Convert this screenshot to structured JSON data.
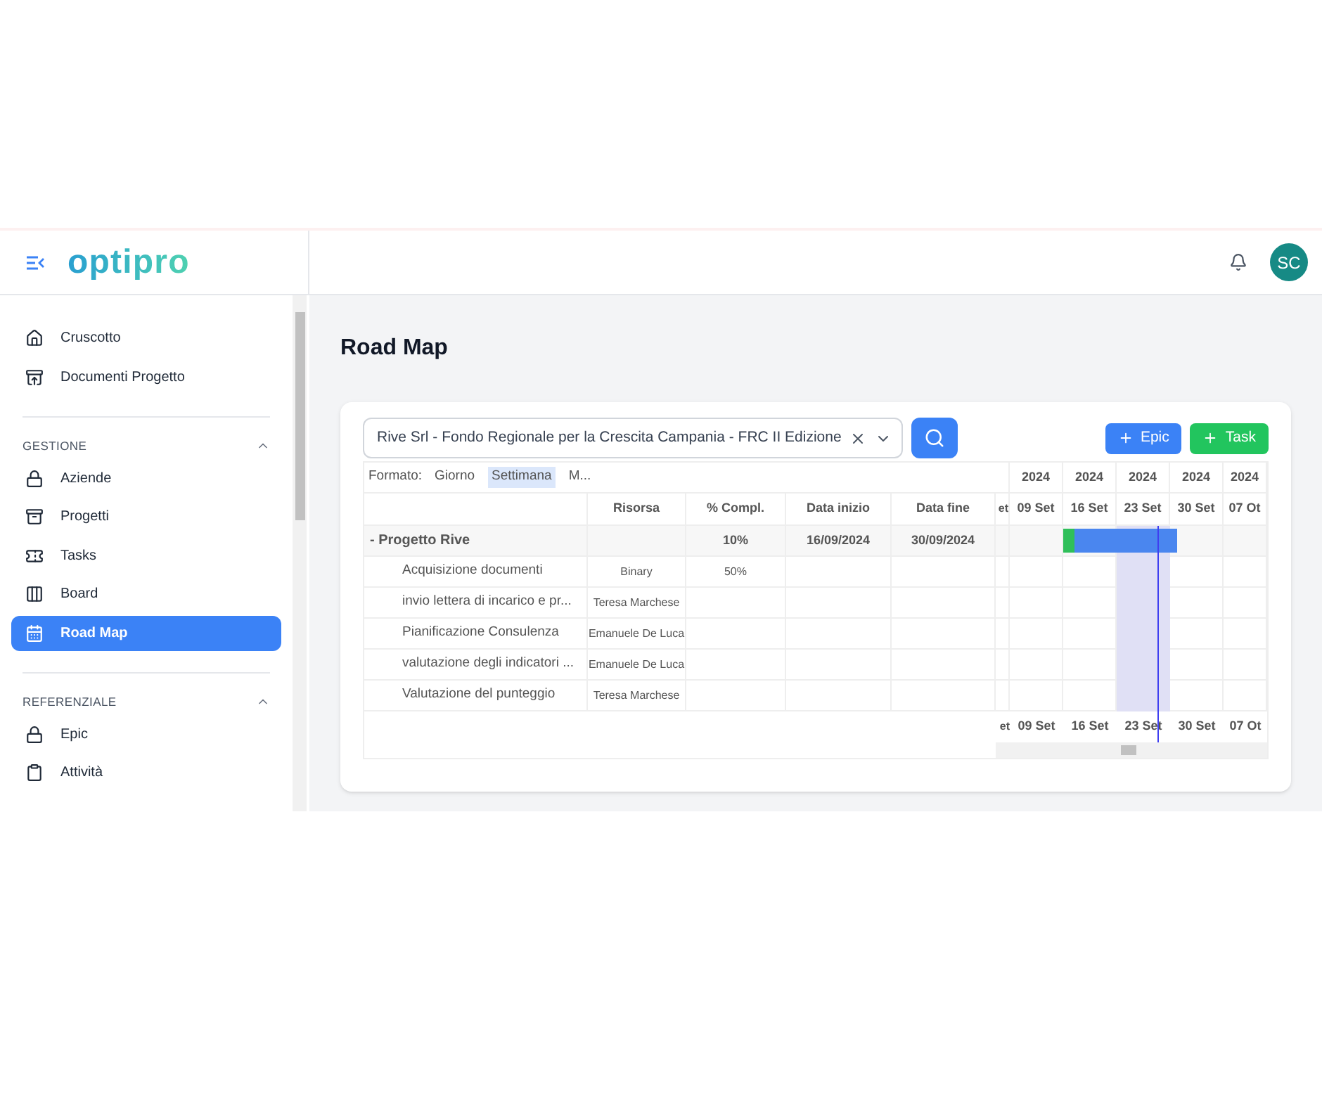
{
  "brand": "optipro",
  "header": {
    "avatar": "SC"
  },
  "sidebar": {
    "top_items": [
      {
        "label": "Cruscotto",
        "selected": false
      },
      {
        "label": "Documenti Progetto",
        "selected": false
      }
    ],
    "sections": [
      {
        "title": "GESTIONE",
        "expanded": true,
        "items": [
          {
            "label": "Aziende",
            "selected": false
          },
          {
            "label": "Progetti",
            "selected": false
          },
          {
            "label": "Tasks",
            "selected": false
          },
          {
            "label": "Board",
            "selected": false
          },
          {
            "label": "Road Map",
            "selected": true
          }
        ]
      },
      {
        "title": "REFERENZIALE",
        "expanded": true,
        "items": [
          {
            "label": "Epic",
            "selected": false
          },
          {
            "label": "Attività",
            "selected": false
          }
        ]
      }
    ]
  },
  "page_title": "Road Map",
  "project_select": {
    "value": "Rive Srl - Fondo Regionale per la Crescita Campania - FRC II Edizione"
  },
  "buttons": [
    {
      "label": "Epic",
      "kind": "epic"
    },
    {
      "label": "Task",
      "kind": "task"
    }
  ],
  "format_bar": {
    "label": "Formato:",
    "options": [
      {
        "label": "Giorno",
        "selected": false
      },
      {
        "label": "Settimana",
        "selected": true
      },
      {
        "label": "M...",
        "selected": false
      }
    ]
  },
  "table": {
    "columns": [
      "Risorsa",
      "% Compl.",
      "Data inizio",
      "Data fine"
    ],
    "rows": [
      {
        "kind": "group",
        "name": "Progetto Rive",
        "toggle": "-",
        "cells": [
          "",
          "10%",
          "16/09/2024",
          "30/09/2024"
        ]
      },
      {
        "kind": "task",
        "name": "Acquisizione documenti",
        "cells": [
          "Binary",
          "50%",
          "",
          ""
        ]
      },
      {
        "kind": "task",
        "name": "invio lettera di incarico e pr...",
        "cells": [
          "Teresa Marchese",
          "",
          "",
          ""
        ]
      },
      {
        "kind": "task",
        "name": "Pianificazione Consulenza",
        "cells": [
          "Emanuele De Luca",
          "",
          "",
          ""
        ]
      },
      {
        "kind": "task",
        "name": "valutazione degli indicatori ...",
        "cells": [
          "Emanuele De Luca",
          "",
          "",
          ""
        ]
      },
      {
        "kind": "task",
        "name": "Valutazione del punteggio",
        "cells": [
          "Teresa Marchese",
          "",
          "",
          ""
        ]
      }
    ]
  },
  "timeline": {
    "years": [
      "2024",
      "2024",
      "2024",
      "2024",
      "2024"
    ],
    "weeks_top": [
      "et",
      "09 Set",
      "16 Set",
      "23 Set",
      "30 Set",
      "07 Ot"
    ],
    "weeks_bottom": [
      "et",
      "09 Set",
      "16 Set",
      "23 Set",
      "30 Set",
      "07 Ot"
    ],
    "bar": {
      "level": 0.1
    }
  }
}
